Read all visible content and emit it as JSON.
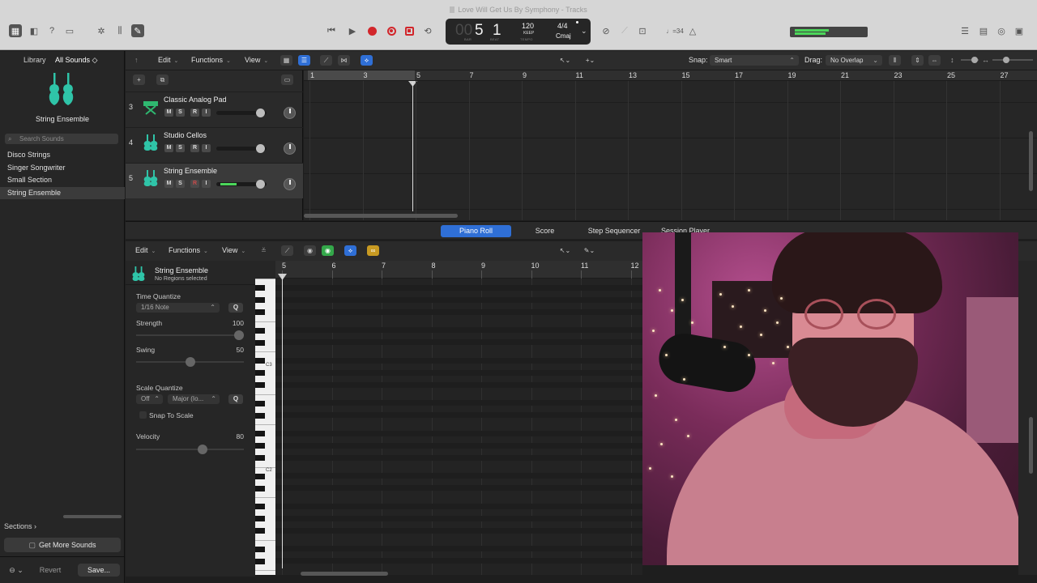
{
  "window": {
    "title": "Love Will Get Us By Symphony - Tracks"
  },
  "lcd": {
    "bar_dim": "00",
    "bar": "5",
    "beat": "1",
    "bar_label": "BAR",
    "beat_label": "BEAT",
    "tempo": "120",
    "tempo_mode": "KEEP",
    "tempo_label": "TEMPO",
    "time_signature": "4/4",
    "key": "Cmaj"
  },
  "toolbar_right": {
    "count_in": "♩=34"
  },
  "library": {
    "title": "Library",
    "filter": "All Sounds ◇",
    "patch_name": "String Ensemble",
    "search_placeholder": "Search Sounds",
    "items": [
      {
        "label": "Disco Strings"
      },
      {
        "label": "Singer Songwriter"
      },
      {
        "label": "Small Section"
      },
      {
        "label": "String Ensemble"
      }
    ],
    "sections_label": "Sections ›",
    "get_more": "Get More Sounds",
    "revert": "Revert",
    "save": "Save..."
  },
  "tracks_bar": {
    "edit": "Edit",
    "functions": "Functions",
    "view": "View",
    "snap_label": "Snap:",
    "snap_value": "Smart",
    "drag_label": "Drag:",
    "drag_value": "No Overlap"
  },
  "tracks": [
    {
      "number": "3",
      "name": "Classic Analog Pad"
    },
    {
      "number": "4",
      "name": "Studio Cellos"
    },
    {
      "number": "5",
      "name": "String Ensemble"
    }
  ],
  "track_buttons": {
    "m": "M",
    "s": "S",
    "r": "R",
    "i": "I"
  },
  "ruler_bars": [
    "1",
    "3",
    "5",
    "7",
    "9",
    "11",
    "13",
    "15",
    "17",
    "19",
    "21",
    "23",
    "25",
    "27"
  ],
  "editor_tabs": [
    "Piano Roll",
    "Score",
    "Step Sequencer",
    "Session Player"
  ],
  "editor_bar": {
    "edit": "Edit",
    "functions": "Functions",
    "view": "View"
  },
  "inspector": {
    "region_name": "String Ensemble",
    "region_status": "No Regions selected",
    "time_quantize_label": "Time Quantize",
    "time_quantize_value": "1/16 Note",
    "q": "Q",
    "strength_label": "Strength",
    "strength_value": "100",
    "swing_label": "Swing",
    "swing_value": "50",
    "scale_quantize_label": "Scale Quantize",
    "scale_off": "Off",
    "scale_mode": "Major (Io...",
    "snap_to_scale": "Snap To Scale",
    "velocity_label": "Velocity",
    "velocity_value": "80"
  },
  "piano_ruler_bars": [
    "5",
    "6",
    "7",
    "8",
    "9",
    "10",
    "11",
    "12"
  ],
  "piano_keys": {
    "c3": "C3",
    "c2": "C2"
  },
  "colors": {
    "accent_blue": "#2f6fd6",
    "record_red": "#d2262b",
    "meter_green": "#4bd65a",
    "instrument_teal": "#2fc4a8"
  }
}
